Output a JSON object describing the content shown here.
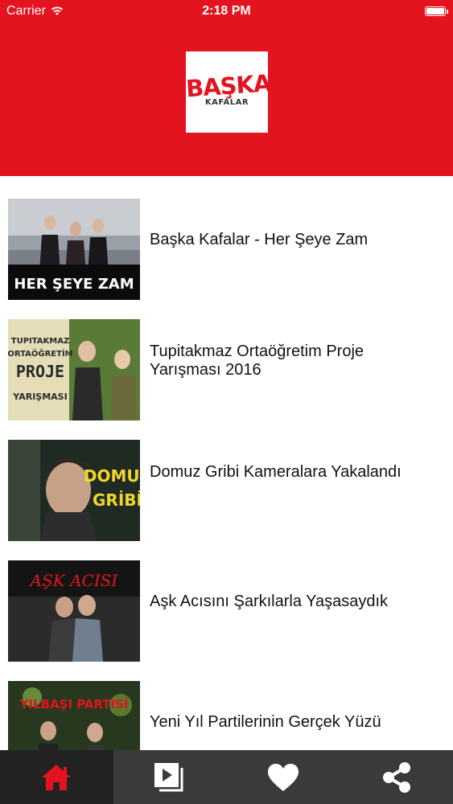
{
  "status_bar": {
    "carrier": "Carrier",
    "time": "2:18 PM"
  },
  "header": {
    "logo_main": "BAŞKA",
    "logo_sub": "KAFALAR"
  },
  "videos": [
    {
      "title": "Başka Kafalar - Her Şeye Zam",
      "thumb_text": "HER ŞEYE ZAM"
    },
    {
      "title": "Tupitakmaz Ortaöğretim Proje Yarışması 2016",
      "thumb_lines": [
        "TUPITAKMAZ",
        "ORTAÖĞRETİM",
        "PROJE",
        "YARIŞMASI"
      ]
    },
    {
      "title": "Domuz Gribi Kameralara Yakalandı",
      "thumb_lines": [
        "DOMUZ",
        "GRİBİ"
      ]
    },
    {
      "title": "Aşk Acısını Şarkılarla Yaşasaydık",
      "thumb_text": "AŞK ACISI"
    },
    {
      "title": "Yeni Yıl Partilerinin Gerçek Yüzü",
      "thumb_text": "YILBAŞI PARTİSİ"
    }
  ],
  "tabs": [
    {
      "icon": "home-icon",
      "active": true
    },
    {
      "icon": "video-list-icon",
      "active": false
    },
    {
      "icon": "heart-icon",
      "active": false
    },
    {
      "icon": "share-icon",
      "active": false
    }
  ],
  "colors": {
    "brand_red": "#e3141f",
    "tab_bg": "#3a3a3a",
    "tab_active_bg": "#222222"
  }
}
